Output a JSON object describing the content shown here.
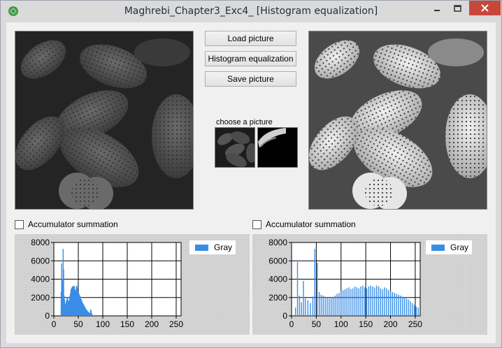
{
  "window": {
    "title": "Maghrebi_Chapter3_Exc4_ [Histogram equalization]"
  },
  "buttons": {
    "load": "Load picture",
    "equalize": "Histogram equalization",
    "save": "Save picture"
  },
  "chooser": {
    "label": "choose a picture"
  },
  "left_panel": {
    "checkbox_label": "Accumulator summation",
    "checked": false
  },
  "right_panel": {
    "checkbox_label": "Accumulator summation",
    "checked": false
  },
  "colors": {
    "series": "#3a8de6",
    "close_button": "#c7483b"
  },
  "chart_data": [
    {
      "type": "bar",
      "title": "",
      "xlabel": "",
      "ylabel": "",
      "xlim": [
        0,
        260
      ],
      "ylim": [
        0,
        8000
      ],
      "x_ticks": [
        "0",
        "50",
        "100",
        "150",
        "200",
        "250"
      ],
      "y_ticks": [
        "0",
        "2000",
        "4000",
        "6000",
        "8000"
      ],
      "grid": true,
      "legend": "top-right",
      "series": [
        {
          "name": "Gray",
          "x": [
            15,
            16,
            17,
            18,
            19,
            20,
            21,
            22,
            23,
            24,
            25,
            26,
            27,
            28,
            29,
            30,
            31,
            32,
            33,
            34,
            35,
            36,
            37,
            38,
            39,
            40,
            41,
            42,
            43,
            44,
            45,
            46,
            47,
            48,
            49,
            50,
            51,
            52,
            53,
            54,
            55,
            56,
            57,
            58,
            59,
            60,
            61,
            62,
            63,
            64,
            65,
            66,
            67,
            68,
            69,
            70,
            71,
            72,
            73,
            74,
            75,
            76,
            77,
            78,
            79,
            80
          ],
          "values": [
            2600,
            5700,
            4000,
            3300,
            7300,
            5100,
            2200,
            1800,
            1300,
            1100,
            1500,
            1700,
            2000,
            1900,
            1700,
            1600,
            1600,
            1900,
            2200,
            2500,
            2900,
            3000,
            3100,
            3200,
            3200,
            3000,
            3300,
            3200,
            2800,
            2700,
            2900,
            3200,
            3300,
            3000,
            2800,
            2600,
            2500,
            2300,
            2200,
            2100,
            1900,
            1800,
            1700,
            1500,
            1400,
            1300,
            1200,
            1100,
            1000,
            900,
            800,
            700,
            650,
            600,
            500,
            450,
            400,
            350,
            300,
            250,
            700,
            600,
            300,
            200,
            100,
            50
          ]
        }
      ]
    },
    {
      "type": "bar",
      "title": "",
      "xlabel": "",
      "ylabel": "",
      "xlim": [
        0,
        260
      ],
      "ylim": [
        0,
        8000
      ],
      "x_ticks": [
        "0",
        "50",
        "100",
        "150",
        "200",
        "250"
      ],
      "y_ticks": [
        "0",
        "2000",
        "4000",
        "6000",
        "8000"
      ],
      "grid": true,
      "legend": "top-right",
      "series": [
        {
          "name": "Gray",
          "x": [
            8,
            12,
            16,
            20,
            24,
            28,
            33,
            38,
            43,
            47,
            52,
            56,
            60,
            64,
            68,
            72,
            76,
            80,
            84,
            88,
            92,
            96,
            100,
            104,
            108,
            112,
            116,
            120,
            124,
            128,
            132,
            136,
            140,
            144,
            148,
            152,
            156,
            160,
            164,
            168,
            172,
            176,
            180,
            184,
            188,
            192,
            196,
            200,
            204,
            208,
            212,
            216,
            220,
            224,
            228,
            232,
            236,
            240,
            244,
            248,
            252,
            256
          ],
          "values": [
            900,
            5900,
            2200,
            1500,
            3800,
            1900,
            1700,
            1400,
            2100,
            7300,
            5800,
            2600,
            2300,
            2200,
            2100,
            2000,
            1900,
            1900,
            2000,
            2200,
            2400,
            2500,
            2700,
            2800,
            2900,
            3000,
            3100,
            2900,
            3000,
            3200,
            3100,
            3000,
            3200,
            3300,
            3100,
            3000,
            3200,
            3300,
            3200,
            3100,
            3300,
            3200,
            3000,
            2900,
            3100,
            3000,
            2800,
            2700,
            2600,
            2500,
            2400,
            2300,
            2200,
            2100,
            2000,
            1900,
            1800,
            1600,
            1400,
            1200,
            1000,
            900
          ]
        }
      ]
    }
  ]
}
